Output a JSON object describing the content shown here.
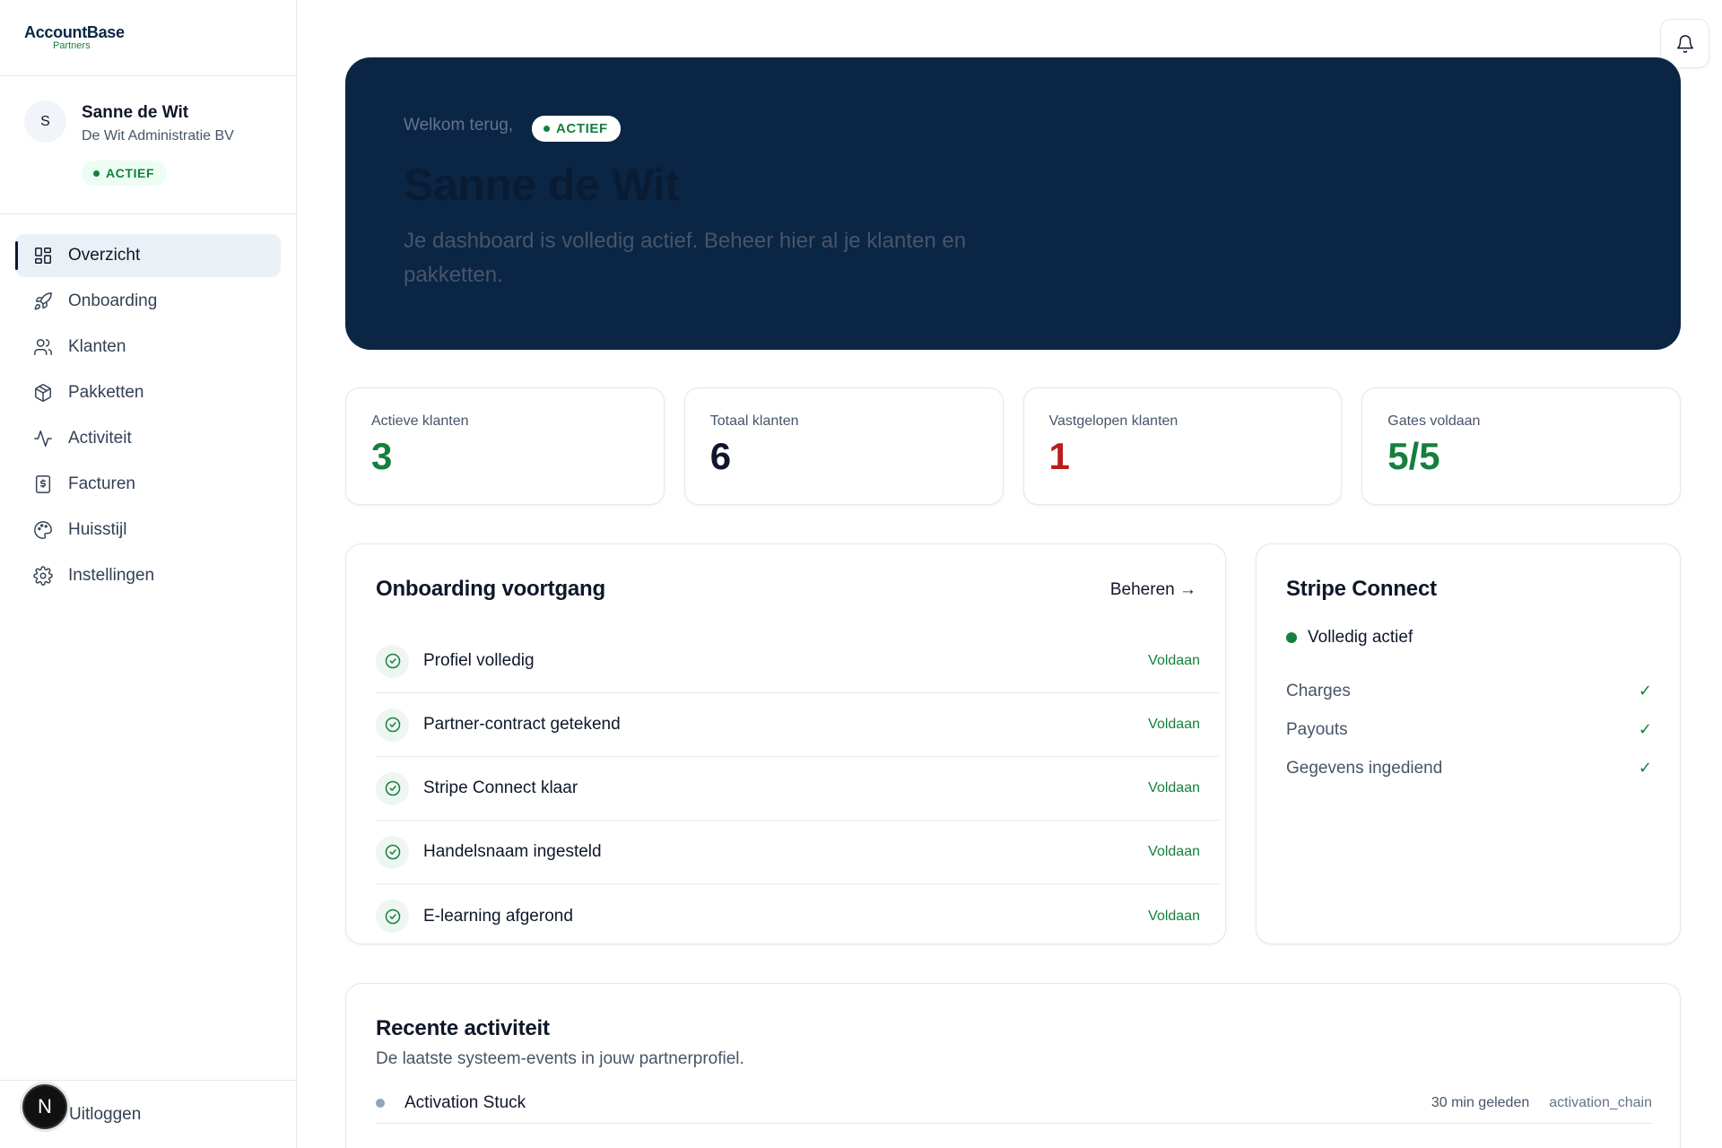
{
  "brand": {
    "name": "AccountBase",
    "sub": "Partners"
  },
  "profile": {
    "initial": "S",
    "name": "Sanne de Wit",
    "company": "De Wit Administratie BV",
    "status": "ACTIEF"
  },
  "nav": [
    {
      "label": "Overzicht",
      "icon": "grid-icon",
      "active": true
    },
    {
      "label": "Onboarding",
      "icon": "rocket-icon"
    },
    {
      "label": "Klanten",
      "icon": "users-icon"
    },
    {
      "label": "Pakketten",
      "icon": "package-icon"
    },
    {
      "label": "Activiteit",
      "icon": "activity-icon"
    },
    {
      "label": "Facturen",
      "icon": "invoice-icon"
    },
    {
      "label": "Huisstijl",
      "icon": "palette-icon"
    },
    {
      "label": "Instellingen",
      "icon": "gear-icon"
    }
  ],
  "logout": {
    "label": "Uitloggen",
    "badge": "N"
  },
  "hero": {
    "welcome": "Welkom terug,",
    "status": "ACTIEF",
    "name": "Sanne de Wit",
    "description": "Je dashboard is volledig actief. Beheer hier al je klanten en pakketten."
  },
  "stats": [
    {
      "label": "Actieve klanten",
      "value": "3",
      "color": "#15803d"
    },
    {
      "label": "Totaal klanten",
      "value": "6",
      "color": "#0f172a"
    },
    {
      "label": "Vastgelopen klanten",
      "value": "1",
      "color": "#b91c1c"
    },
    {
      "label": "Gates voldaan",
      "value": "5/5",
      "color": "#15803d"
    }
  ],
  "onboarding": {
    "title": "Onboarding voortgang",
    "manage": "Beheren →",
    "steps": [
      {
        "label": "Profiel volledig",
        "status": "Voldaan"
      },
      {
        "label": "Partner-contract getekend",
        "status": "Voldaan"
      },
      {
        "label": "Stripe Connect klaar",
        "status": "Voldaan"
      },
      {
        "label": "Handelsnaam ingesteld",
        "status": "Voldaan"
      },
      {
        "label": "E-learning afgerond",
        "status": "Voldaan"
      }
    ]
  },
  "stripe": {
    "title": "Stripe Connect",
    "status": "Volledig actief",
    "rows": [
      {
        "label": "Charges",
        "check": "✓"
      },
      {
        "label": "Payouts",
        "check": "✓"
      },
      {
        "label": "Gegevens ingediend",
        "check": "✓"
      }
    ]
  },
  "activity": {
    "title": "Recente activiteit",
    "subtitle": "De laatste systeem-events in jouw partnerprofiel.",
    "items": [
      {
        "title": "Activation Stuck",
        "time": "30 min geleden",
        "source": "activation_chain"
      }
    ]
  }
}
